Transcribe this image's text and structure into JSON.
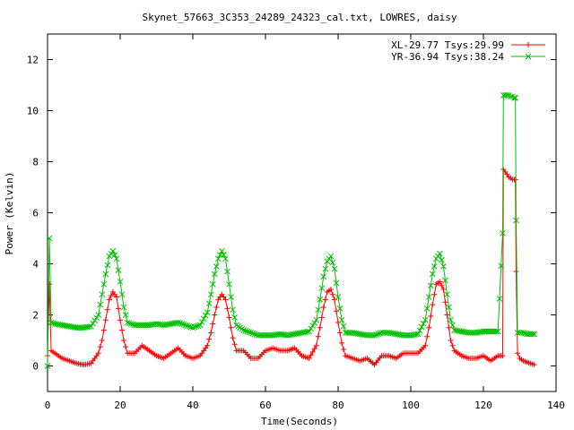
{
  "chart_data": {
    "type": "line",
    "title": "Skynet_57663_3C353_24289_24323_cal.txt, LOWRES, daisy",
    "xlabel": "Time(Seconds)",
    "ylabel": "Power (Kelvin)",
    "xlim": [
      0,
      140
    ],
    "ylim": [
      -1,
      13
    ],
    "xticks": [
      "0",
      "20",
      "40",
      "60",
      "80",
      "100",
      "120",
      "140"
    ],
    "yticks": [
      "0",
      "2",
      "4",
      "6",
      "8",
      "10",
      "12"
    ],
    "grid": false,
    "legend_position": "top-right",
    "series": [
      {
        "name": "XL-29.77 Tsys:29.99",
        "color": "#ff0000",
        "marker": "plus",
        "points": [
          [
            0.0,
            0.4
          ],
          [
            0.5,
            3.2
          ],
          [
            1.0,
            0.6
          ],
          [
            2,
            0.5
          ],
          [
            4,
            0.3
          ],
          [
            6,
            0.2
          ],
          [
            8,
            0.1
          ],
          [
            10,
            0.05
          ],
          [
            12,
            0.1
          ],
          [
            14,
            0.5
          ],
          [
            15,
            1.0
          ],
          [
            16,
            1.8
          ],
          [
            17,
            2.6
          ],
          [
            18,
            2.9
          ],
          [
            19,
            2.7
          ],
          [
            20,
            1.8
          ],
          [
            21,
            1.0
          ],
          [
            22,
            0.5
          ],
          [
            24,
            0.5
          ],
          [
            26,
            0.8
          ],
          [
            28,
            0.6
          ],
          [
            30,
            0.4
          ],
          [
            32,
            0.3
          ],
          [
            34,
            0.5
          ],
          [
            36,
            0.7
          ],
          [
            38,
            0.4
          ],
          [
            40,
            0.3
          ],
          [
            42,
            0.4
          ],
          [
            44,
            0.8
          ],
          [
            45,
            1.3
          ],
          [
            46,
            2.0
          ],
          [
            47,
            2.6
          ],
          [
            48,
            2.8
          ],
          [
            49,
            2.6
          ],
          [
            50,
            1.9
          ],
          [
            51,
            1.1
          ],
          [
            52,
            0.6
          ],
          [
            54,
            0.6
          ],
          [
            56,
            0.3
          ],
          [
            58,
            0.3
          ],
          [
            60,
            0.6
          ],
          [
            62,
            0.7
          ],
          [
            64,
            0.6
          ],
          [
            66,
            0.6
          ],
          [
            68,
            0.7
          ],
          [
            70,
            0.4
          ],
          [
            72,
            0.3
          ],
          [
            74,
            0.8
          ],
          [
            75,
            1.5
          ],
          [
            76,
            2.3
          ],
          [
            77,
            2.9
          ],
          [
            78,
            3.0
          ],
          [
            79,
            2.6
          ],
          [
            80,
            1.7
          ],
          [
            81,
            0.9
          ],
          [
            82,
            0.4
          ],
          [
            84,
            0.3
          ],
          [
            86,
            0.2
          ],
          [
            88,
            0.3
          ],
          [
            90,
            0.05
          ],
          [
            92,
            0.4
          ],
          [
            94,
            0.4
          ],
          [
            96,
            0.3
          ],
          [
            98,
            0.5
          ],
          [
            100,
            0.5
          ],
          [
            102,
            0.5
          ],
          [
            104,
            0.8
          ],
          [
            105,
            1.5
          ],
          [
            106,
            2.4
          ],
          [
            107,
            3.2
          ],
          [
            108,
            3.3
          ],
          [
            109,
            3.0
          ],
          [
            110,
            2.0
          ],
          [
            111,
            1.0
          ],
          [
            112,
            0.6
          ],
          [
            114,
            0.4
          ],
          [
            116,
            0.3
          ],
          [
            118,
            0.3
          ],
          [
            120,
            0.4
          ],
          [
            122,
            0.2
          ],
          [
            124,
            0.4
          ],
          [
            125.3,
            0.4
          ],
          [
            125.5,
            7.7
          ],
          [
            126,
            7.6
          ],
          [
            126.5,
            7.5
          ],
          [
            127,
            7.4
          ],
          [
            127.5,
            7.35
          ],
          [
            128,
            7.3
          ],
          [
            128.5,
            7.3
          ],
          [
            128.8,
            7.3
          ],
          [
            129,
            3.7
          ],
          [
            129.4,
            0.5
          ],
          [
            130,
            0.3
          ],
          [
            131,
            0.2
          ],
          [
            132,
            0.15
          ],
          [
            133,
            0.1
          ],
          [
            134,
            0.05
          ]
        ]
      },
      {
        "name": "YR-36.94 Tsys:38.24",
        "color": "#00c000",
        "marker": "cross",
        "points": [
          [
            0.0,
            0.0
          ],
          [
            0.5,
            5.0
          ],
          [
            1.0,
            1.7
          ],
          [
            2,
            1.65
          ],
          [
            4,
            1.6
          ],
          [
            6,
            1.55
          ],
          [
            8,
            1.5
          ],
          [
            10,
            1.5
          ],
          [
            12,
            1.55
          ],
          [
            14,
            2.0
          ],
          [
            15,
            2.8
          ],
          [
            16,
            3.6
          ],
          [
            17,
            4.3
          ],
          [
            18,
            4.5
          ],
          [
            19,
            4.2
          ],
          [
            20,
            3.3
          ],
          [
            21,
            2.3
          ],
          [
            22,
            1.7
          ],
          [
            24,
            1.6
          ],
          [
            26,
            1.6
          ],
          [
            28,
            1.6
          ],
          [
            30,
            1.65
          ],
          [
            32,
            1.6
          ],
          [
            34,
            1.65
          ],
          [
            36,
            1.7
          ],
          [
            38,
            1.6
          ],
          [
            40,
            1.5
          ],
          [
            42,
            1.6
          ],
          [
            44,
            2.1
          ],
          [
            45,
            2.8
          ],
          [
            46,
            3.6
          ],
          [
            47,
            4.2
          ],
          [
            48,
            4.5
          ],
          [
            49,
            4.2
          ],
          [
            50,
            3.2
          ],
          [
            51,
            2.2
          ],
          [
            52,
            1.6
          ],
          [
            54,
            1.4
          ],
          [
            56,
            1.3
          ],
          [
            58,
            1.2
          ],
          [
            60,
            1.2
          ],
          [
            62,
            1.2
          ],
          [
            64,
            1.25
          ],
          [
            66,
            1.2
          ],
          [
            68,
            1.25
          ],
          [
            70,
            1.3
          ],
          [
            72,
            1.35
          ],
          [
            74,
            1.8
          ],
          [
            75,
            2.6
          ],
          [
            76,
            3.5
          ],
          [
            77,
            4.1
          ],
          [
            78,
            4.3
          ],
          [
            79,
            3.8
          ],
          [
            80,
            2.7
          ],
          [
            81,
            1.8
          ],
          [
            82,
            1.3
          ],
          [
            84,
            1.3
          ],
          [
            86,
            1.25
          ],
          [
            88,
            1.2
          ],
          [
            90,
            1.2
          ],
          [
            92,
            1.3
          ],
          [
            94,
            1.3
          ],
          [
            96,
            1.25
          ],
          [
            98,
            1.2
          ],
          [
            100,
            1.2
          ],
          [
            102,
            1.25
          ],
          [
            104,
            1.8
          ],
          [
            105,
            2.7
          ],
          [
            106,
            3.6
          ],
          [
            107,
            4.2
          ],
          [
            108,
            4.4
          ],
          [
            109,
            3.9
          ],
          [
            110,
            2.8
          ],
          [
            111,
            1.8
          ],
          [
            112,
            1.4
          ],
          [
            114,
            1.35
          ],
          [
            116,
            1.3
          ],
          [
            118,
            1.3
          ],
          [
            120,
            1.35
          ],
          [
            122,
            1.35
          ],
          [
            124,
            1.35
          ],
          [
            125.3,
            5.2
          ],
          [
            125.5,
            10.6
          ],
          [
            126,
            10.6
          ],
          [
            126.5,
            10.6
          ],
          [
            127,
            10.6
          ],
          [
            127.5,
            10.55
          ],
          [
            128,
            10.55
          ],
          [
            128.5,
            10.5
          ],
          [
            128.8,
            10.5
          ],
          [
            129,
            5.7
          ],
          [
            129.4,
            1.3
          ],
          [
            130,
            1.3
          ],
          [
            131,
            1.3
          ],
          [
            132,
            1.25
          ],
          [
            133,
            1.25
          ],
          [
            134,
            1.25
          ]
        ]
      }
    ]
  }
}
